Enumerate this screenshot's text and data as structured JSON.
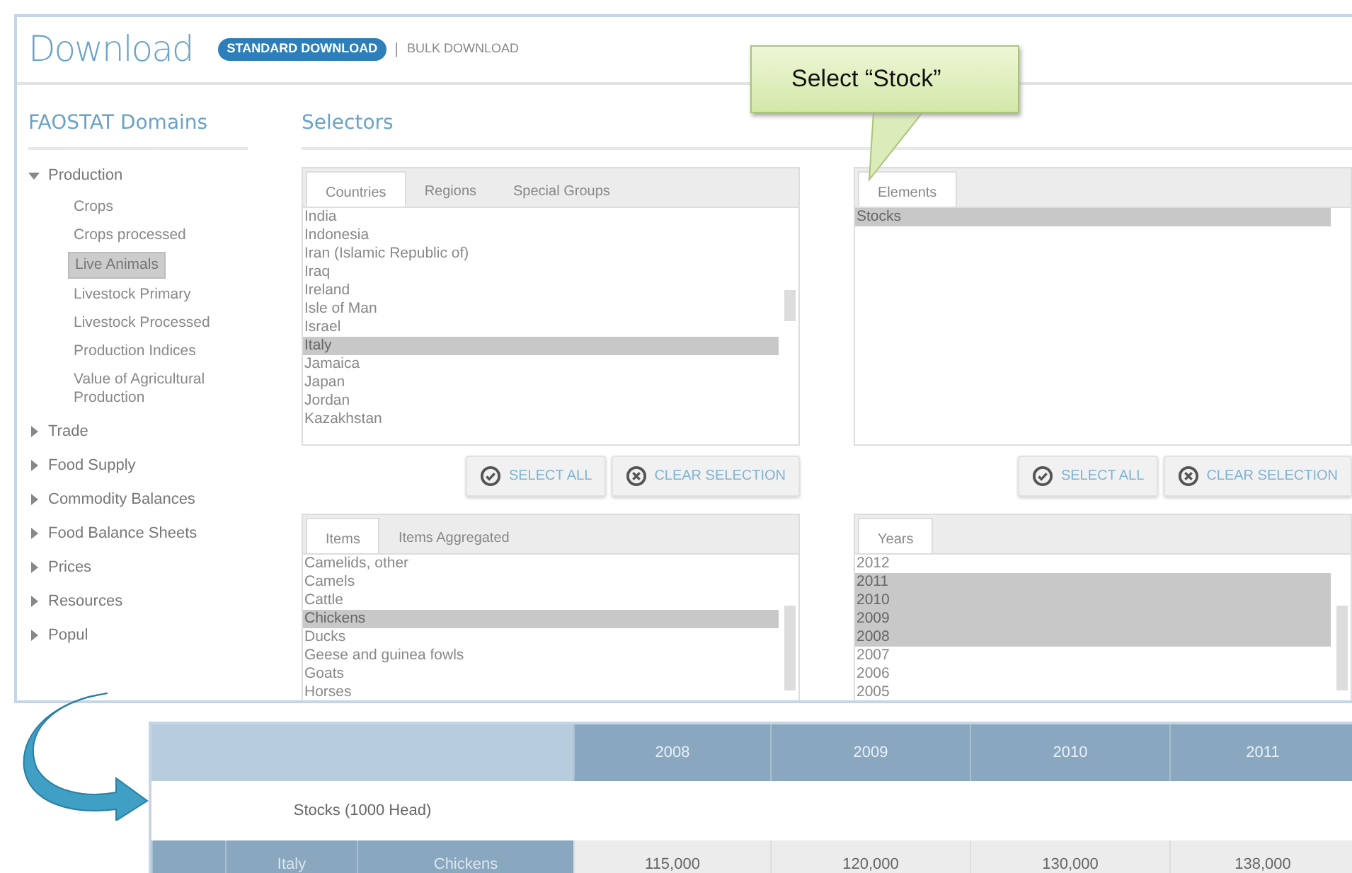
{
  "header": {
    "title": "Download",
    "separator": "|",
    "tabs": [
      {
        "label": "STANDARD DOWNLOAD",
        "selected": true
      },
      {
        "label": "BULK DOWNLOAD",
        "selected": false
      }
    ]
  },
  "sidebar": {
    "title": "FAOSTAT Domains",
    "items": [
      {
        "label": "Production",
        "expanded": true,
        "children": [
          {
            "label": "Crops",
            "selected": false
          },
          {
            "label": "Crops processed",
            "selected": false
          },
          {
            "label": "Live Animals",
            "selected": true
          },
          {
            "label": "Livestock Primary",
            "selected": false
          },
          {
            "label": "Livestock Processed",
            "selected": false
          },
          {
            "label": "Production Indices",
            "selected": false
          },
          {
            "label": "Value of Agricultural Production",
            "selected": false
          }
        ]
      },
      {
        "label": "Trade",
        "expanded": false
      },
      {
        "label": "Food Supply",
        "expanded": false
      },
      {
        "label": "Commodity Balances",
        "expanded": false
      },
      {
        "label": "Food Balance Sheets",
        "expanded": false
      },
      {
        "label": "Prices",
        "expanded": false
      },
      {
        "label": "Resources",
        "expanded": false
      },
      {
        "label": "Popul",
        "expanded": false
      }
    ]
  },
  "selectors": {
    "title": "Selectors",
    "panels": [
      {
        "tabs": [
          {
            "label": "Countries",
            "selected": true
          },
          {
            "label": "Regions",
            "selected": false
          },
          {
            "label": "Special Groups",
            "selected": false
          }
        ],
        "items": [
          {
            "label": "India",
            "selected": false
          },
          {
            "label": "Indonesia",
            "selected": false
          },
          {
            "label": "Iran (Islamic Republic of)",
            "selected": false
          },
          {
            "label": "Iraq",
            "selected": false
          },
          {
            "label": "Ireland",
            "selected": false
          },
          {
            "label": "Isle of Man",
            "selected": false
          },
          {
            "label": "Israel",
            "selected": false
          },
          {
            "label": "Italy",
            "selected": true
          },
          {
            "label": "Jamaica",
            "selected": false
          },
          {
            "label": "Japan",
            "selected": false
          },
          {
            "label": "Jordan",
            "selected": false
          },
          {
            "label": "Kazakhstan",
            "selected": false
          }
        ],
        "buttons": [
          "SELECT ALL",
          "CLEAR SELECTION"
        ]
      },
      {
        "tabs": [
          {
            "label": "Elements",
            "selected": true
          }
        ],
        "items": [
          {
            "label": "Stocks",
            "selected": true
          }
        ],
        "buttons": [
          "SELECT ALL",
          "CLEAR SELECTION"
        ]
      },
      {
        "tabs": [
          {
            "label": "Items",
            "selected": true
          },
          {
            "label": "Items Aggregated",
            "selected": false
          }
        ],
        "items": [
          {
            "label": "Camelids, other",
            "selected": false
          },
          {
            "label": "Camels",
            "selected": false
          },
          {
            "label": "Cattle",
            "selected": false
          },
          {
            "label": "Chickens",
            "selected": true
          },
          {
            "label": "Ducks",
            "selected": false
          },
          {
            "label": "Geese and guinea fowls",
            "selected": false
          },
          {
            "label": "Goats",
            "selected": false
          },
          {
            "label": "Horses",
            "selected": false
          }
        ]
      },
      {
        "tabs": [
          {
            "label": "Years",
            "selected": true
          }
        ],
        "items": [
          {
            "label": "2012",
            "selected": false
          },
          {
            "label": "2011",
            "selected": true
          },
          {
            "label": "2010",
            "selected": true
          },
          {
            "label": "2009",
            "selected": true
          },
          {
            "label": "2008",
            "selected": true
          },
          {
            "label": "2007",
            "selected": false
          },
          {
            "label": "2006",
            "selected": false
          },
          {
            "label": "2005",
            "selected": false
          }
        ]
      }
    ]
  },
  "callout": {
    "text": "Select “Stock”"
  },
  "result_table": {
    "columns": [
      "2008",
      "2009",
      "2010",
      "2011"
    ],
    "element": "Stocks (1000 Head)",
    "rows": [
      {
        "country": "Italy",
        "item": "Chickens",
        "values": [
          "115,000",
          "120,000",
          "130,000",
          "138,000"
        ]
      }
    ]
  }
}
